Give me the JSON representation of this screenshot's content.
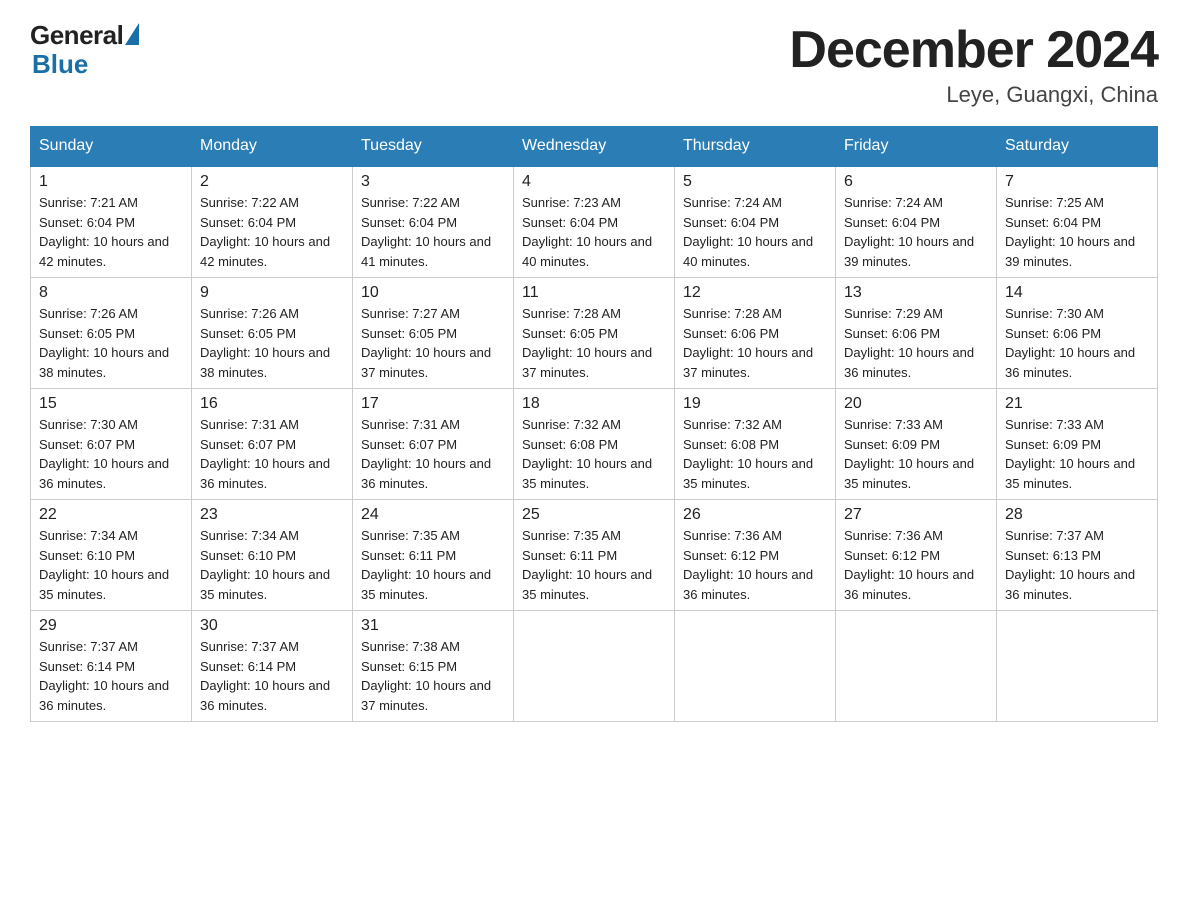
{
  "header": {
    "logo_general": "General",
    "logo_blue": "Blue",
    "title": "December 2024",
    "subtitle": "Leye, Guangxi, China"
  },
  "weekdays": [
    "Sunday",
    "Monday",
    "Tuesday",
    "Wednesday",
    "Thursday",
    "Friday",
    "Saturday"
  ],
  "weeks": [
    [
      {
        "day": "1",
        "sunrise": "7:21 AM",
        "sunset": "6:04 PM",
        "daylight": "10 hours and 42 minutes."
      },
      {
        "day": "2",
        "sunrise": "7:22 AM",
        "sunset": "6:04 PM",
        "daylight": "10 hours and 42 minutes."
      },
      {
        "day": "3",
        "sunrise": "7:22 AM",
        "sunset": "6:04 PM",
        "daylight": "10 hours and 41 minutes."
      },
      {
        "day": "4",
        "sunrise": "7:23 AM",
        "sunset": "6:04 PM",
        "daylight": "10 hours and 40 minutes."
      },
      {
        "day": "5",
        "sunrise": "7:24 AM",
        "sunset": "6:04 PM",
        "daylight": "10 hours and 40 minutes."
      },
      {
        "day": "6",
        "sunrise": "7:24 AM",
        "sunset": "6:04 PM",
        "daylight": "10 hours and 39 minutes."
      },
      {
        "day": "7",
        "sunrise": "7:25 AM",
        "sunset": "6:04 PM",
        "daylight": "10 hours and 39 minutes."
      }
    ],
    [
      {
        "day": "8",
        "sunrise": "7:26 AM",
        "sunset": "6:05 PM",
        "daylight": "10 hours and 38 minutes."
      },
      {
        "day": "9",
        "sunrise": "7:26 AM",
        "sunset": "6:05 PM",
        "daylight": "10 hours and 38 minutes."
      },
      {
        "day": "10",
        "sunrise": "7:27 AM",
        "sunset": "6:05 PM",
        "daylight": "10 hours and 37 minutes."
      },
      {
        "day": "11",
        "sunrise": "7:28 AM",
        "sunset": "6:05 PM",
        "daylight": "10 hours and 37 minutes."
      },
      {
        "day": "12",
        "sunrise": "7:28 AM",
        "sunset": "6:06 PM",
        "daylight": "10 hours and 37 minutes."
      },
      {
        "day": "13",
        "sunrise": "7:29 AM",
        "sunset": "6:06 PM",
        "daylight": "10 hours and 36 minutes."
      },
      {
        "day": "14",
        "sunrise": "7:30 AM",
        "sunset": "6:06 PM",
        "daylight": "10 hours and 36 minutes."
      }
    ],
    [
      {
        "day": "15",
        "sunrise": "7:30 AM",
        "sunset": "6:07 PM",
        "daylight": "10 hours and 36 minutes."
      },
      {
        "day": "16",
        "sunrise": "7:31 AM",
        "sunset": "6:07 PM",
        "daylight": "10 hours and 36 minutes."
      },
      {
        "day": "17",
        "sunrise": "7:31 AM",
        "sunset": "6:07 PM",
        "daylight": "10 hours and 36 minutes."
      },
      {
        "day": "18",
        "sunrise": "7:32 AM",
        "sunset": "6:08 PM",
        "daylight": "10 hours and 35 minutes."
      },
      {
        "day": "19",
        "sunrise": "7:32 AM",
        "sunset": "6:08 PM",
        "daylight": "10 hours and 35 minutes."
      },
      {
        "day": "20",
        "sunrise": "7:33 AM",
        "sunset": "6:09 PM",
        "daylight": "10 hours and 35 minutes."
      },
      {
        "day": "21",
        "sunrise": "7:33 AM",
        "sunset": "6:09 PM",
        "daylight": "10 hours and 35 minutes."
      }
    ],
    [
      {
        "day": "22",
        "sunrise": "7:34 AM",
        "sunset": "6:10 PM",
        "daylight": "10 hours and 35 minutes."
      },
      {
        "day": "23",
        "sunrise": "7:34 AM",
        "sunset": "6:10 PM",
        "daylight": "10 hours and 35 minutes."
      },
      {
        "day": "24",
        "sunrise": "7:35 AM",
        "sunset": "6:11 PM",
        "daylight": "10 hours and 35 minutes."
      },
      {
        "day": "25",
        "sunrise": "7:35 AM",
        "sunset": "6:11 PM",
        "daylight": "10 hours and 35 minutes."
      },
      {
        "day": "26",
        "sunrise": "7:36 AM",
        "sunset": "6:12 PM",
        "daylight": "10 hours and 36 minutes."
      },
      {
        "day": "27",
        "sunrise": "7:36 AM",
        "sunset": "6:12 PM",
        "daylight": "10 hours and 36 minutes."
      },
      {
        "day": "28",
        "sunrise": "7:37 AM",
        "sunset": "6:13 PM",
        "daylight": "10 hours and 36 minutes."
      }
    ],
    [
      {
        "day": "29",
        "sunrise": "7:37 AM",
        "sunset": "6:14 PM",
        "daylight": "10 hours and 36 minutes."
      },
      {
        "day": "30",
        "sunrise": "7:37 AM",
        "sunset": "6:14 PM",
        "daylight": "10 hours and 36 minutes."
      },
      {
        "day": "31",
        "sunrise": "7:38 AM",
        "sunset": "6:15 PM",
        "daylight": "10 hours and 37 minutes."
      },
      null,
      null,
      null,
      null
    ]
  ],
  "labels": {
    "sunrise_prefix": "Sunrise: ",
    "sunset_prefix": "Sunset: ",
    "daylight_prefix": "Daylight: "
  }
}
